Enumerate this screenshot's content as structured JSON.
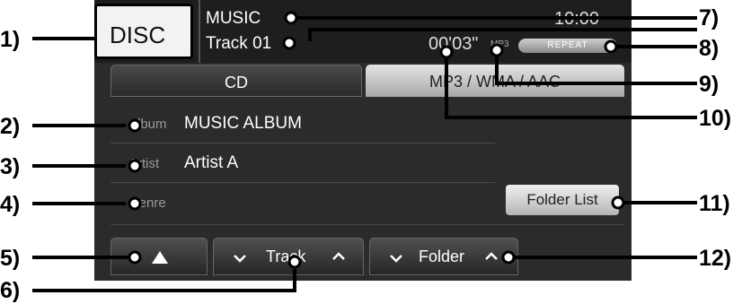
{
  "header": {
    "source_label": "DISC",
    "folder_name": "MUSIC",
    "track_name": "Track 01",
    "clock": "10:00",
    "elapsed_time": "00'03\"",
    "file_format": "MP3",
    "repeat_label": "REPEAT"
  },
  "tabs": [
    {
      "label": "CD",
      "active": false
    },
    {
      "label": "MP3 / WMA / AAC",
      "active": true
    }
  ],
  "info": {
    "album_label": "Album",
    "album_value": "MUSIC ALBUM",
    "artist_label": "Artist",
    "artist_value": "Artist A",
    "genre_label": "Genre",
    "genre_value": ""
  },
  "buttons": {
    "folder_list": "Folder List",
    "track": "Track",
    "folder": "Folder"
  },
  "callouts": [
    "1)",
    "2)",
    "3)",
    "4)",
    "5)",
    "6)",
    "7)",
    "8)",
    "9)",
    "10)",
    "11)",
    "12)"
  ],
  "colors": {
    "screen_bg": "#2b2b2b",
    "header_bg": "#1e1e1e",
    "active_tab": "#d0d0d0"
  }
}
